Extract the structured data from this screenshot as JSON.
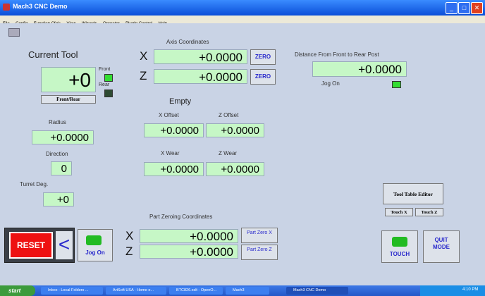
{
  "window": {
    "title": "Mach3 CNC Demo"
  },
  "menu": [
    "File",
    "Config",
    "Function Cfg's",
    "View",
    "Wizards",
    "Operator",
    "PlugIn Control",
    "Help"
  ],
  "current_tool": {
    "title": "Current Tool",
    "value": "+0",
    "front_label": "Front",
    "rear_label": "Rear",
    "front_rear_button": "Front/Rear"
  },
  "axis": {
    "title": "Axis Coordinates",
    "x_label": "X",
    "x_value": "+0.0000",
    "z_label": "Z",
    "z_value": "+0.0000",
    "zero_label": "ZERO"
  },
  "distance": {
    "title": "Distance From Front to Rear Post",
    "value": "+0.0000",
    "jog_on_label": "Jog On"
  },
  "tool_desc": "Empty",
  "offsets": {
    "x_offset_label": "X Offset",
    "x_offset": "+0.0000",
    "z_offset_label": "Z Offset",
    "z_offset": "+0.0000"
  },
  "wear": {
    "x_wear_label": "X Wear",
    "x_wear": "+0.0000",
    "z_wear_label": "Z Wear",
    "z_wear": "+0.0000"
  },
  "radius": {
    "label": "Radius",
    "value": "+0.0000"
  },
  "direction": {
    "label": "Direction",
    "value": "0"
  },
  "turret": {
    "label": "Turret Deg.",
    "value": "+0"
  },
  "tool_table": {
    "editor_label": "Tool Table Editor",
    "touch_x": "Touch X",
    "touch_z": "Touch Z"
  },
  "part_zero": {
    "title": "Part Zeroing Coordinates",
    "x_label": "X",
    "x_value": "+0.0000",
    "x_button": "Part Zero X",
    "z_label": "Z",
    "z_value": "+0.0000",
    "z_button": "Part Zero Z"
  },
  "bottom": {
    "reset": "RESET",
    "back_glyph": "<",
    "jog_on": "Jog On",
    "touch": "TOUCH",
    "quit_mode": "QUIT MODE"
  },
  "taskbar": {
    "start": "start",
    "tasks": [
      "Inbox - Local Folders ...",
      "ArtSoft USA - Home o...",
      "BTC826.xslt - OpenO...",
      "Mach3",
      "Mach3 CNC Demo"
    ],
    "clock": "4:10 PM"
  },
  "colors": {
    "dro_green": "#c6f7c6",
    "led_on": "#33dd33",
    "reset_red": "#ee1111",
    "zero_blue": "#2a2acc"
  }
}
